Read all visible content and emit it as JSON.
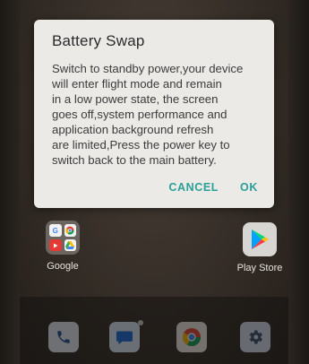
{
  "dialog": {
    "title": "Battery Swap",
    "message": "Switch to standby power,your device\nwill enter flight mode and remain\nin a low power state, the screen\ngoes off,system performance and\napplication background refresh\nare limited,Press the power key to\nswitch back to the main battery.",
    "cancel_label": "CANCEL",
    "ok_label": "OK",
    "accent_color": "#2aa098"
  },
  "home": {
    "apps": [
      {
        "label": "Google",
        "icon": "google-folder-icon"
      },
      {
        "label": "Play Store",
        "icon": "play-store-icon"
      }
    ],
    "dock": [
      {
        "icon": "phone-icon"
      },
      {
        "icon": "messages-icon"
      },
      {
        "icon": "chrome-icon"
      },
      {
        "icon": "settings-icon"
      }
    ]
  }
}
